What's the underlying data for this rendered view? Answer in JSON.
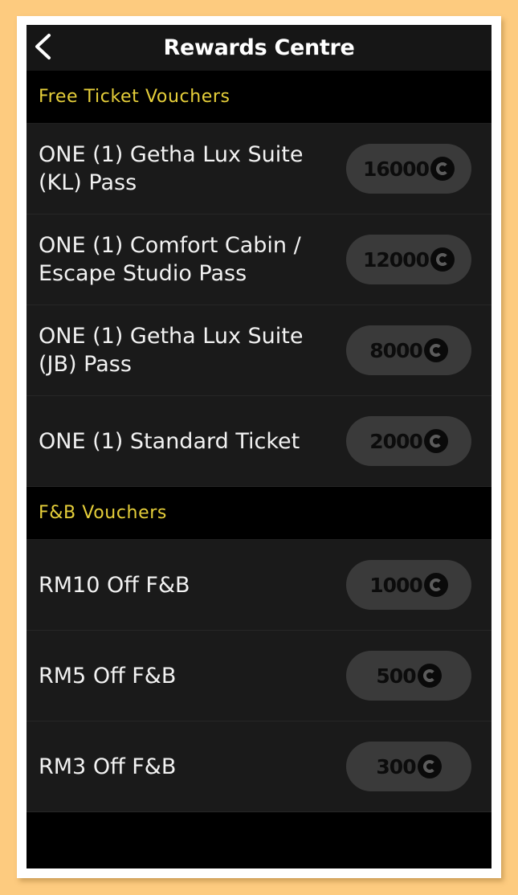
{
  "header": {
    "title": "Rewards Centre"
  },
  "sections": [
    {
      "title": "Free Ticket Vouchers",
      "items": [
        {
          "label": "ONE (1) Getha Lux Suite (KL) Pass",
          "points": "16000"
        },
        {
          "label": "ONE (1) Comfort Cabin / Escape Studio Pass",
          "points": "12000"
        },
        {
          "label": "ONE (1) Getha Lux Suite (JB) Pass",
          "points": "8000"
        },
        {
          "label": "ONE (1) Standard Ticket",
          "points": "2000"
        }
      ]
    },
    {
      "title": "F&B Vouchers",
      "items": [
        {
          "label": "RM10 Off F&B",
          "points": "1000"
        },
        {
          "label": "RM5 Off F&B",
          "points": "500"
        },
        {
          "label": "RM3 Off F&B",
          "points": "300"
        }
      ]
    }
  ],
  "colors": {
    "accent": "#e6cf3a",
    "page_background": "#fdcb7f",
    "row_background": "#1a1a1a",
    "pill_background": "#3a3a3a"
  },
  "icons": {
    "back": "chevron-left-icon",
    "coin": "coin-icon"
  }
}
